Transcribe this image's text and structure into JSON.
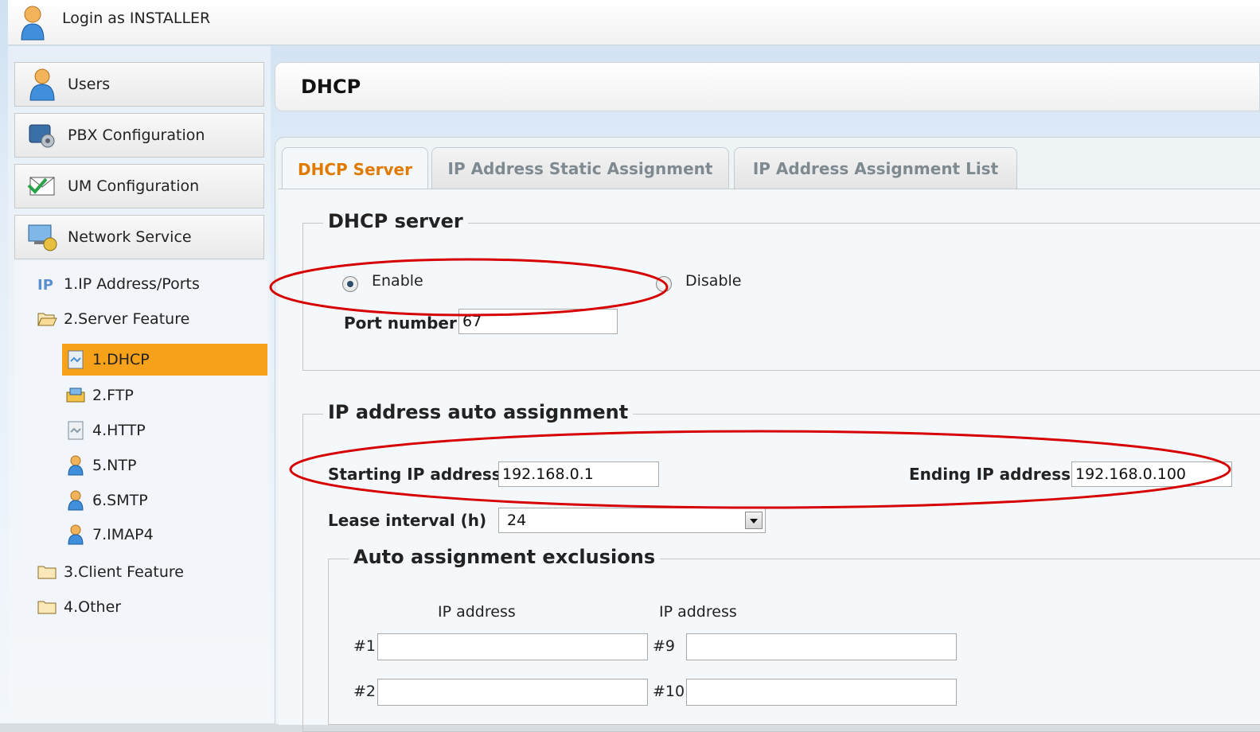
{
  "topbar": {
    "login_text": "Login as INSTALLER"
  },
  "sidebar": {
    "menu": [
      {
        "label": "Users",
        "icon": "users-icon"
      },
      {
        "label": "PBX Configuration",
        "icon": "pbx-config-icon"
      },
      {
        "label": "UM Configuration",
        "icon": "um-config-icon"
      },
      {
        "label": "Network Service",
        "icon": "network-service-icon"
      }
    ],
    "tree": [
      {
        "label": "1.IP Address/Ports",
        "icon": "ip-icon"
      },
      {
        "label": "2.Server Feature",
        "icon": "folder-open-icon"
      },
      {
        "label": "1.DHCP",
        "icon": "dhcp-icon",
        "active": true
      },
      {
        "label": "2.FTP",
        "icon": "ftp-icon"
      },
      {
        "label": "4.HTTP",
        "icon": "http-icon"
      },
      {
        "label": "5.NTP",
        "icon": "ntp-user-icon"
      },
      {
        "label": "6.SMTP",
        "icon": "smtp-user-icon"
      },
      {
        "label": "7.IMAP4",
        "icon": "imap4-user-icon"
      },
      {
        "label": "3.Client Feature",
        "icon": "folder-icon"
      },
      {
        "label": "4.Other",
        "icon": "folder-icon"
      }
    ]
  },
  "header": {
    "title": "DHCP"
  },
  "tabs": [
    {
      "label": "DHCP Server",
      "active": true
    },
    {
      "label": "IP Address Static Assignment",
      "active": false
    },
    {
      "label": "IP Address Assignment List",
      "active": false
    }
  ],
  "dhcp_server": {
    "legend": "DHCP server",
    "enable_label": "Enable",
    "disable_label": "Disable",
    "selected": "Enable",
    "port_label": "Port number",
    "port_value": "67"
  },
  "auto_assignment": {
    "legend": "IP address auto assignment",
    "start_label": "Starting IP address",
    "start_value": "192.168.0.1",
    "end_label": "Ending IP address",
    "end_value": "192.168.0.100",
    "lease_label": "Lease interval (h)",
    "lease_value": "24"
  },
  "exclusions": {
    "legend": "Auto assignment exclusions",
    "col1_header": "IP address",
    "col2_header": "IP address",
    "rows": [
      {
        "left_label": "#1",
        "left_value": "",
        "right_label": "#9",
        "right_value": ""
      },
      {
        "left_label": "#2",
        "left_value": "",
        "right_label": "#10",
        "right_value": ""
      }
    ]
  },
  "colors": {
    "accent": "#f5a21a",
    "active_tab_text": "#e07b00",
    "annotation": "#d60000"
  }
}
